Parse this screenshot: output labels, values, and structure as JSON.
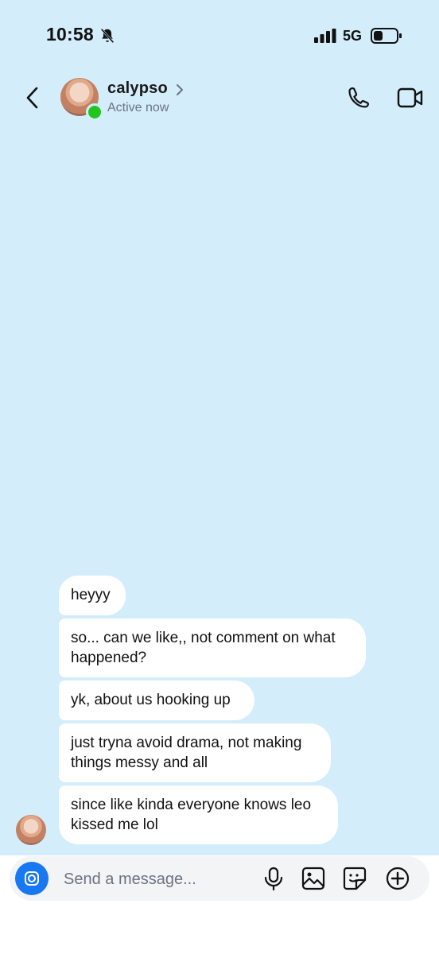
{
  "status_bar": {
    "time": "10:58",
    "network": "5G",
    "icons": [
      "bell-off-icon",
      "signal-icon",
      "battery-icon"
    ]
  },
  "header": {
    "contact_name": "calypso",
    "contact_status": "Active now",
    "icons": [
      "chevron-left-icon",
      "chevron-right-icon",
      "phone-icon",
      "video-icon"
    ],
    "online_color": "#22c51e"
  },
  "messages": [
    {
      "text": "heyyy"
    },
    {
      "text": "so... can we like,, not comment on what happened?"
    },
    {
      "text": "yk, about us hooking up"
    },
    {
      "text": "just tryna avoid drama, not making things messy and all"
    },
    {
      "text": "since like kinda everyone knows leo kissed me lol"
    }
  ],
  "composer": {
    "placeholder": "Send a message...",
    "value": "",
    "icons": [
      "camera-icon",
      "microphone-icon",
      "image-icon",
      "sticker-icon",
      "plus-icon"
    ],
    "accent_color": "#1877f2"
  },
  "colors": {
    "background": "#d4edfb",
    "bubble": "#ffffff"
  }
}
